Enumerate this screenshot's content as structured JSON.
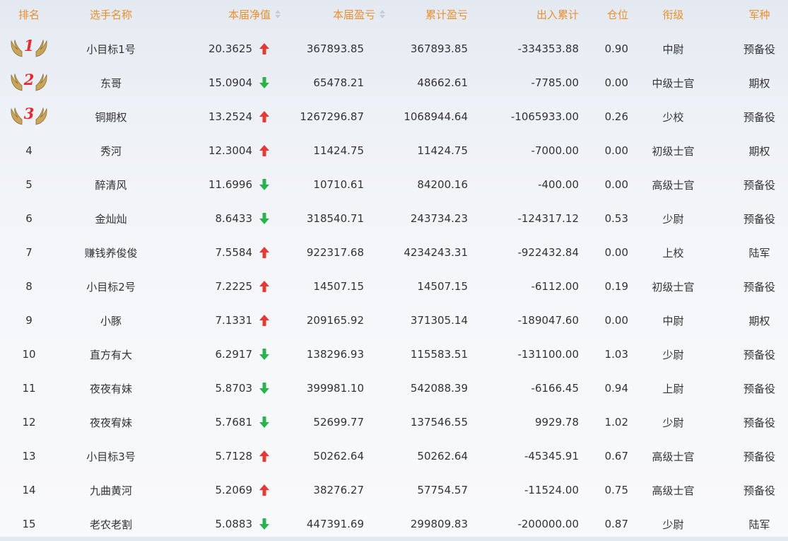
{
  "headers": {
    "rank": "排名",
    "name": "选手名称",
    "net_value": "本届净值",
    "current_pnl": "本届盈亏",
    "cumulative_pnl": "累计盈亏",
    "flow": "出入累计",
    "position": "仓位",
    "rank_title": "衔级",
    "army": "军种"
  },
  "colors": {
    "header_text": "#e8902f",
    "arrow_up": "#e53935",
    "arrow_down": "#2bb24c",
    "medal_number": "#e8282e"
  },
  "rows": [
    {
      "rank": "1",
      "medal": true,
      "name": "小目标1号",
      "net": "20.3625",
      "trend": "up",
      "cur": "367893.85",
      "cum": "367893.85",
      "flow": "-334353.88",
      "pos": "0.90",
      "title": "中尉",
      "army": "预备役"
    },
    {
      "rank": "2",
      "medal": true,
      "name": "东哥",
      "net": "15.0904",
      "trend": "down",
      "cur": "65478.21",
      "cum": "48662.61",
      "flow": "-7785.00",
      "pos": "0.00",
      "title": "中级士官",
      "army": "期权"
    },
    {
      "rank": "3",
      "medal": true,
      "name": "铜期权",
      "net": "13.2524",
      "trend": "up",
      "cur": "1267296.87",
      "cum": "1068944.64",
      "flow": "-1065933.00",
      "pos": "0.26",
      "title": "少校",
      "army": "预备役"
    },
    {
      "rank": "4",
      "medal": false,
      "name": "秀河",
      "net": "12.3004",
      "trend": "up",
      "cur": "11424.75",
      "cum": "11424.75",
      "flow": "-7000.00",
      "pos": "0.00",
      "title": "初级士官",
      "army": "期权"
    },
    {
      "rank": "5",
      "medal": false,
      "name": "醉清风",
      "net": "11.6996",
      "trend": "down",
      "cur": "10710.61",
      "cum": "84200.16",
      "flow": "-400.00",
      "pos": "0.00",
      "title": "高级士官",
      "army": "预备役"
    },
    {
      "rank": "6",
      "medal": false,
      "name": "金灿灿",
      "net": "8.6433",
      "trend": "down",
      "cur": "318540.71",
      "cum": "243734.23",
      "flow": "-124317.12",
      "pos": "0.53",
      "title": "少尉",
      "army": "预备役"
    },
    {
      "rank": "7",
      "medal": false,
      "name": "赚钱养俊俊",
      "net": "7.5584",
      "trend": "up",
      "cur": "922317.68",
      "cum": "4234243.31",
      "flow": "-922432.84",
      "pos": "0.00",
      "title": "上校",
      "army": "陆军"
    },
    {
      "rank": "8",
      "medal": false,
      "name": "小目标2号",
      "net": "7.2225",
      "trend": "up",
      "cur": "14507.15",
      "cum": "14507.15",
      "flow": "-6112.00",
      "pos": "0.19",
      "title": "初级士官",
      "army": "预备役"
    },
    {
      "rank": "9",
      "medal": false,
      "name": "小豚",
      "net": "7.1331",
      "trend": "up",
      "cur": "209165.92",
      "cum": "371305.14",
      "flow": "-189047.60",
      "pos": "0.00",
      "title": "中尉",
      "army": "期权"
    },
    {
      "rank": "10",
      "medal": false,
      "name": "直方有大",
      "net": "6.2917",
      "trend": "down",
      "cur": "138296.93",
      "cum": "115583.51",
      "flow": "-131100.00",
      "pos": "1.03",
      "title": "少尉",
      "army": "预备役"
    },
    {
      "rank": "11",
      "medal": false,
      "name": "夜夜有妹",
      "net": "5.8703",
      "trend": "down",
      "cur": "399981.10",
      "cum": "542088.39",
      "flow": "-6166.45",
      "pos": "0.94",
      "title": "上尉",
      "army": "预备役"
    },
    {
      "rank": "12",
      "medal": false,
      "name": "夜夜宥妹",
      "net": "5.7681",
      "trend": "down",
      "cur": "52699.77",
      "cum": "137546.55",
      "flow": "9929.78",
      "pos": "1.02",
      "title": "少尉",
      "army": "预备役"
    },
    {
      "rank": "13",
      "medal": false,
      "name": "小目标3号",
      "net": "5.7128",
      "trend": "up",
      "cur": "50262.64",
      "cum": "50262.64",
      "flow": "-45345.91",
      "pos": "0.67",
      "title": "高级士官",
      "army": "预备役"
    },
    {
      "rank": "14",
      "medal": false,
      "name": "九曲黄河",
      "net": "5.2069",
      "trend": "up",
      "cur": "38276.27",
      "cum": "57754.57",
      "flow": "-11524.00",
      "pos": "0.75",
      "title": "高级士官",
      "army": "预备役"
    },
    {
      "rank": "15",
      "medal": false,
      "name": "老农老割",
      "net": "5.0883",
      "trend": "down",
      "cur": "447391.69",
      "cum": "299809.83",
      "flow": "-200000.00",
      "pos": "0.87",
      "title": "少尉",
      "army": "陆军"
    }
  ]
}
